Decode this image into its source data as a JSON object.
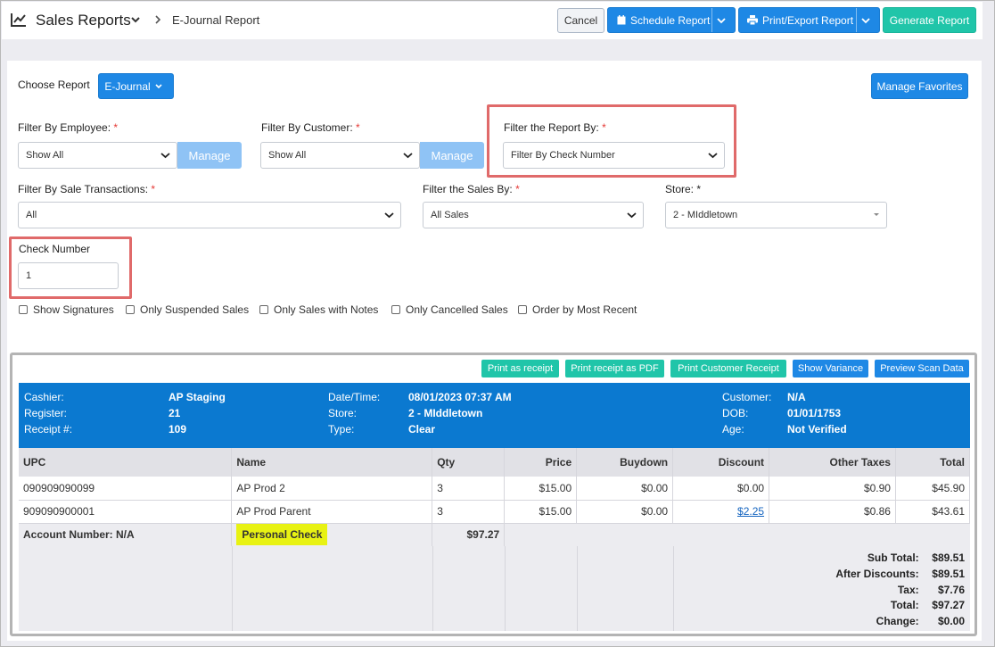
{
  "header": {
    "title": "Sales Reports",
    "breadcrumb": "E-Journal Report",
    "cancel": "Cancel",
    "schedule": "Schedule Report",
    "print_export": "Print/Export Report",
    "generate": "Generate Report"
  },
  "choose": {
    "label": "Choose Report",
    "value": "E-Journal",
    "manage_favorites": "Manage Favorites"
  },
  "filters": {
    "employee_label": "Filter By Employee:",
    "employee_value": "Show All",
    "customer_label": "Filter By Customer:",
    "customer_value": "Show All",
    "manage": "Manage",
    "report_by_label": "Filter the Report By:",
    "report_by_value": "Filter By Check Number",
    "sale_tx_label": "Filter By Sale Transactions:",
    "sale_tx_value": "All",
    "sales_by_label": "Filter the Sales By:",
    "sales_by_value": "All Sales",
    "store_label": "Store: *",
    "store_value": "2 - MIddletown",
    "check_label": "Check Number",
    "check_value": "1",
    "required_mark": "*"
  },
  "options": [
    "Show Signatures",
    "Only Suspended Sales",
    "Only Sales with Notes",
    "Only Cancelled Sales",
    "Order by Most Recent"
  ],
  "report_buttons": [
    "Print as receipt",
    "Print receipt as PDF",
    "Print Customer Receipt",
    "Show Variance",
    "Preview Scan Data"
  ],
  "receipt": {
    "cashier_l": "Cashier:",
    "cashier_v": "AP Staging",
    "register_l": "Register:",
    "register_v": "21",
    "receipt_l": "Receipt #:",
    "receipt_v": "109",
    "date_l": "Date/Time:",
    "date_v": "08/01/2023 07:37 AM",
    "store_l": "Store:",
    "store_v": "2 - MIddletown",
    "type_l": "Type:",
    "type_v": "Clear",
    "customer_l": "Customer:",
    "customer_v": "N/A",
    "dob_l": "DOB:",
    "dob_v": "01/01/1753",
    "age_l": "Age:",
    "age_v": "Not Verified"
  },
  "table": {
    "headers": [
      "UPC",
      "Name",
      "Qty",
      "Price",
      "Buydown",
      "Discount",
      "Other Taxes",
      "Total"
    ],
    "rows": [
      [
        "090909090099",
        "AP Prod 2",
        "3",
        "$15.00",
        "$0.00",
        "$0.00",
        "$0.90",
        "$45.90"
      ],
      [
        "909090900001",
        "AP Prod Parent",
        "3",
        "$15.00",
        "$0.00",
        "$2.25",
        "$0.86",
        "$43.61"
      ]
    ],
    "account": "Account Number: N/A",
    "payment": "Personal Check",
    "payment_amount": "$97.27"
  },
  "totals": [
    [
      "Sub Total:",
      "$89.51"
    ],
    [
      "After Discounts:",
      "$89.51"
    ],
    [
      "Tax:",
      "$7.76"
    ],
    [
      "Total:",
      "$97.27"
    ],
    [
      "Change:",
      "$0.00"
    ]
  ]
}
